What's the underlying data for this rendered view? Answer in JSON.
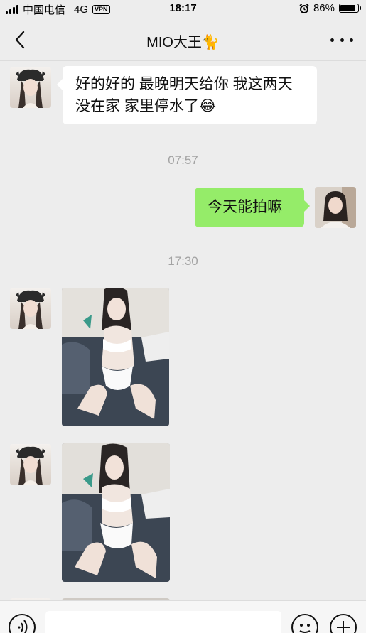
{
  "status_bar": {
    "carrier": "中国电信",
    "network": "4G",
    "vpn": "VPN",
    "time": "18:17",
    "battery_percent": "86%",
    "battery_level": 0.86
  },
  "nav": {
    "title": "MIO大王🐈"
  },
  "messages": {
    "msg1_text": "好的好的 最晚明天给你 我这两天没在家 家里停水了😂",
    "time1": "07:57",
    "msg2_text": "今天能拍嘛",
    "time2": "17:30"
  },
  "colors": {
    "background": "#ededed",
    "outgoing_bubble": "#95ec69",
    "incoming_bubble": "#ffffff"
  }
}
